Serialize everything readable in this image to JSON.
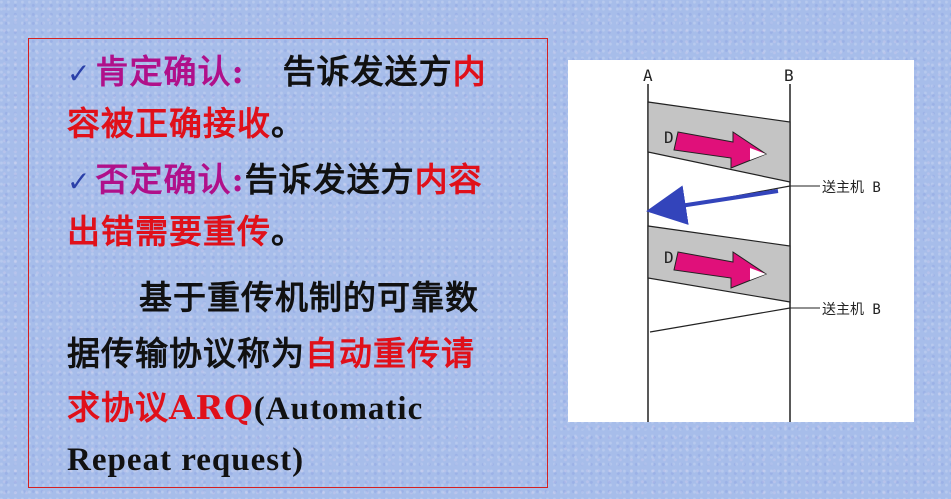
{
  "text": {
    "positive_ack_term": "肯定确认:",
    "positive_ack_desc": "告诉发送方",
    "positive_ack_red1": "内",
    "positive_ack_red2": "容被正确接收",
    "positive_ack_end": "。",
    "negative_ack_term": "否定确认:",
    "negative_ack_desc": "告诉发送方",
    "negative_ack_red1": "内容",
    "negative_ack_red2": "出错需要重传",
    "negative_ack_end": "。",
    "para_line1": "基于重传机制的可靠数",
    "para_line2_black": "据传输协议称为",
    "para_line2_red": "自动重传请",
    "para_line3_red": "求协议ARQ",
    "para_line3_black": "(Automatic",
    "para_line4": "Repeat request)"
  },
  "diagram": {
    "label_a": "A",
    "label_b": "B",
    "frame_label_1": "D",
    "frame_label_2": "D",
    "nak_label_1": "送主机 B",
    "nak_label_2": "送主机 B"
  },
  "colors": {
    "red": "#e0101a",
    "magenta": "#b0108a",
    "arrow_pink": "#e0107a",
    "arrow_blue": "#3344bb",
    "band_gray": "#c4c4c4"
  },
  "icons": {
    "bullet": "check-mark-icon"
  }
}
